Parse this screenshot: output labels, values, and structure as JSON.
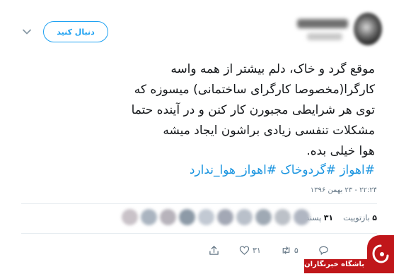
{
  "header": {
    "follow_label": "دنبال کنید"
  },
  "tweet": {
    "lines": [
      "موقع گرد و خاک، دلم بیشتر از همه واسه",
      "کارگرا(مخصوصا کارگرای ساختمانی) میسوزه که",
      "توی هر شرایطی مجبورن کار کنن و در آینده حتما",
      "مشکلات تنفسی زیادی براشون ایجاد میشه",
      "هوا خیلی بده."
    ],
    "hashtags": [
      "#اهواز",
      "#گردوخاک",
      "#اهواز_هوا_ندارد"
    ],
    "timestamp": "۲۲:۲۴ - ۲۳ بهمن ۱۳۹۶"
  },
  "stats": {
    "retweet_count": "۵",
    "retweet_label": "بازتوییت",
    "like_count": "۳۱",
    "like_label": "پسند"
  },
  "likers": {
    "colors": [
      "#c9c2c8",
      "#aab4c0",
      "#b7b3bb",
      "#8d9aa7",
      "#c2c9d3",
      "#a3a8b5",
      "#b9c0ca",
      "#9fa9b4",
      "#bcc1c8",
      "#b0b6c2"
    ]
  },
  "actions": {
    "reply_count": "",
    "retweet_count": "۵",
    "like_count": "۳۱"
  },
  "watermark": {
    "text": "باشگاه خبرنگاران"
  },
  "colors": {
    "accent": "#1da1f2",
    "hashtag": "#1b95e0",
    "watermark": "#c0161a"
  }
}
